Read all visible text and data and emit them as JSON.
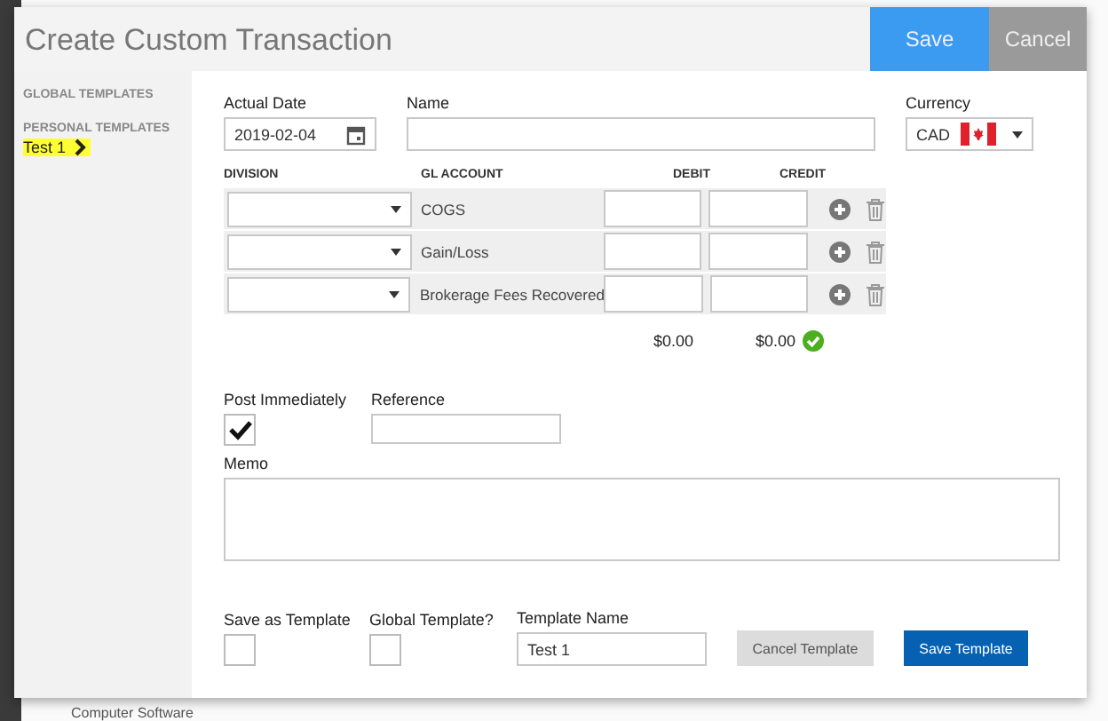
{
  "background": {
    "labels": [
      "Computer Software"
    ]
  },
  "dialog": {
    "title": "Create Custom Transaction",
    "actions": [
      {
        "label": "Save",
        "kind": "primary"
      },
      {
        "label": "Cancel",
        "kind": "secondary"
      }
    ]
  },
  "sidebar": {
    "sections": [
      {
        "heading": "GLOBAL TEMPLATES"
      },
      {
        "heading": "PERSONAL TEMPLATES",
        "items": [
          {
            "label": "Test 1",
            "highlighted": true
          }
        ]
      }
    ]
  },
  "actual_date": {
    "label": "Actual Date",
    "value": "2019-02-04"
  },
  "name": {
    "label": "Name"
  },
  "currency": {
    "label": "Currency",
    "value": "CAD"
  },
  "lines": {
    "columns": [
      "DIVISION",
      "GL ACCOUNT",
      "DEBIT",
      "CREDIT"
    ],
    "rows": [
      {
        "gl_account": "COGS"
      },
      {
        "gl_account": "Gain/Loss"
      },
      {
        "gl_account": "Brokerage Fees Recovered"
      }
    ],
    "totals": {
      "debit": "$0.00",
      "credit": "$0.00",
      "balanced": true
    }
  },
  "post_immediately": {
    "label": "Post Immediately",
    "checked": true
  },
  "reference": {
    "label": "Reference"
  },
  "memo": {
    "label": "Memo"
  },
  "save_as_template": {
    "label": "Save as Template",
    "checked": false
  },
  "global_template": {
    "label": "Global Template?",
    "checked": false
  },
  "template_name": {
    "label": "Template Name",
    "value": "Test 1"
  },
  "template_buttons": [
    {
      "label": "Cancel Template",
      "kind": "secondary"
    },
    {
      "label": "Save Template",
      "kind": "primary"
    }
  ]
}
